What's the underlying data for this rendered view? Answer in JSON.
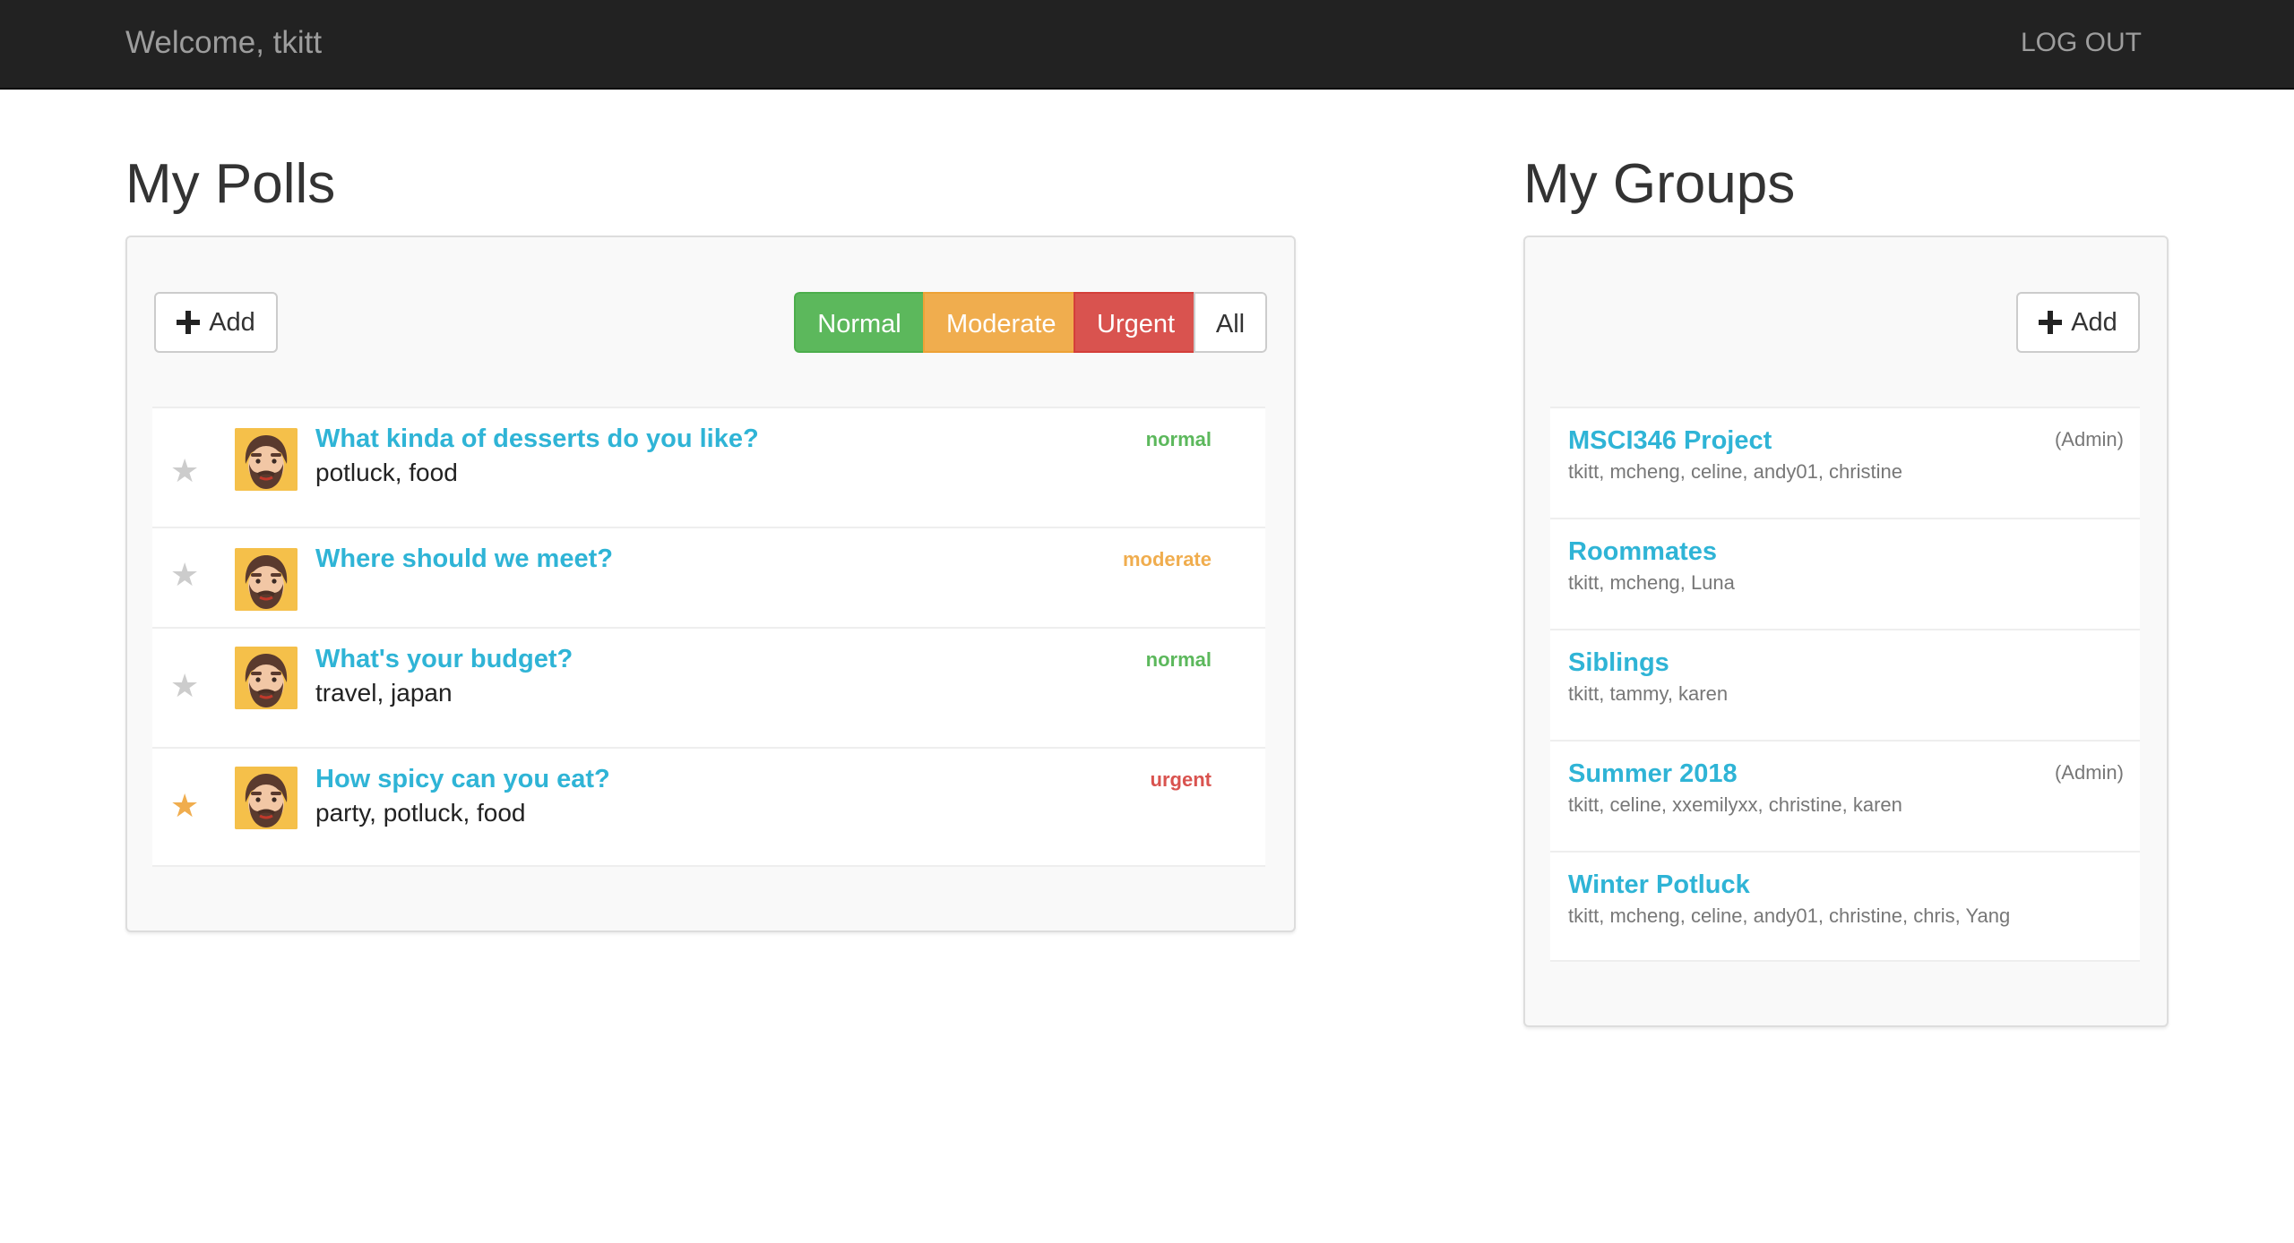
{
  "navbar": {
    "welcome": "Welcome, tkitt",
    "logout": "LOG OUT"
  },
  "polls": {
    "title": "My Polls",
    "add_label": "Add",
    "filters": {
      "normal": "Normal",
      "moderate": "Moderate",
      "urgent": "Urgent",
      "all": "All"
    },
    "items": [
      {
        "title": "What kinda of desserts do you like?",
        "tags": "potluck, food",
        "priority": "normal",
        "starred": false
      },
      {
        "title": "Where should we meet?",
        "tags": "",
        "priority": "moderate",
        "starred": false
      },
      {
        "title": "What's your budget?",
        "tags": "travel, japan",
        "priority": "normal",
        "starred": false
      },
      {
        "title": "How spicy can you eat?",
        "tags": "party, potluck, food",
        "priority": "urgent",
        "starred": true
      }
    ]
  },
  "groups": {
    "title": "My Groups",
    "add_label": "Add",
    "items": [
      {
        "name": "MSCI346 Project",
        "members": "tkitt, mcheng, celine, andy01, christine",
        "admin": "(Admin)"
      },
      {
        "name": "Roommates",
        "members": "tkitt, mcheng, Luna",
        "admin": ""
      },
      {
        "name": "Siblings",
        "members": "tkitt, tammy, karen",
        "admin": ""
      },
      {
        "name": "Summer 2018",
        "members": "tkitt, celine, xxemilyxx, christine, karen",
        "admin": "(Admin)"
      },
      {
        "name": "Winter Potluck",
        "members": "tkitt, mcheng, celine, andy01, christine, chris, Yang",
        "admin": ""
      }
    ]
  },
  "colors": {
    "link": "#2fb4d6",
    "normal": "#5cb85c",
    "moderate": "#f0ad4e",
    "urgent": "#d9534f",
    "star_active": "#f0ad4e",
    "star_inactive": "#cccccc"
  },
  "icons": {
    "add": "plus-icon",
    "star": "star-icon",
    "avatar": "bearded-man-avatar"
  }
}
